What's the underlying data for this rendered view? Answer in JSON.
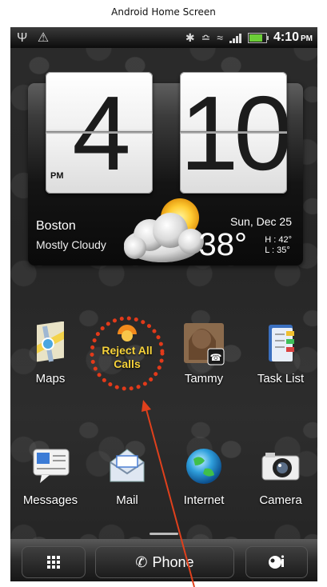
{
  "caption": "Android Home Screen",
  "status_bar": {
    "time": "4:10",
    "ampm": "PM",
    "icons": [
      "usb-icon",
      "warning-icon",
      "bluetooth-icon",
      "vibrate-icon",
      "wifi-icon",
      "signal-icon",
      "battery-icon"
    ]
  },
  "clock": {
    "hour": "4",
    "minutes": "10",
    "ampm": "PM"
  },
  "weather": {
    "city": "Boston",
    "condition": "Mostly Cloudy",
    "date": "Sun, Dec 25",
    "temp": "38°",
    "high": "H : 42°",
    "low": "L : 35°"
  },
  "apps_row1": [
    {
      "label": "Maps",
      "icon": "maps-icon"
    },
    {
      "label": "Reject All Calls",
      "icon": "reject-calls-icon"
    },
    {
      "label": "Tammy",
      "icon": "contact-photo-icon"
    },
    {
      "label": "Task List",
      "icon": "task-list-icon"
    }
  ],
  "apps_row2": [
    {
      "label": "Messages",
      "icon": "messages-icon"
    },
    {
      "label": "Mail",
      "icon": "mail-icon"
    },
    {
      "label": "Internet",
      "icon": "globe-icon"
    },
    {
      "label": "Camera",
      "icon": "camera-icon"
    }
  ],
  "widget_label": {
    "line1": "Reject All",
    "line2": "Calls"
  },
  "dock": {
    "phone_label": "Phone"
  },
  "colors": {
    "highlight_dots": "#e23a1a",
    "arrow": "#e0401c",
    "reject_text": "#f6d23a"
  }
}
